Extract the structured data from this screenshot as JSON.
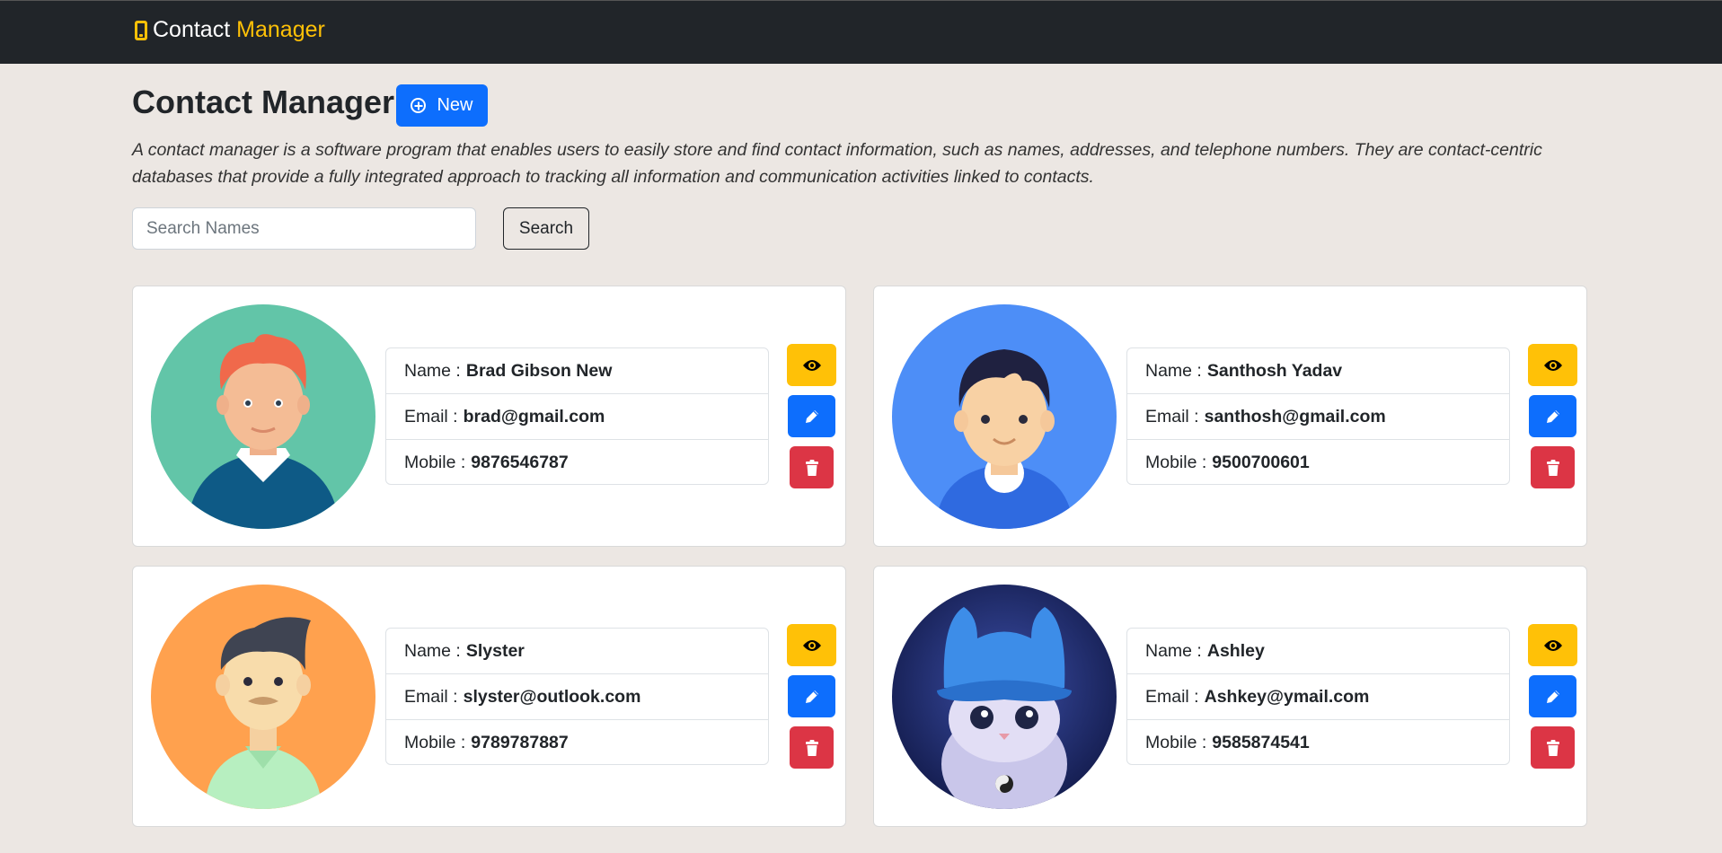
{
  "navbar": {
    "brand_text": "Contact",
    "brand_accent": "Manager",
    "brand_icon": "mobile-phone-icon",
    "accent_color": "#ffc107"
  },
  "header": {
    "title": "Contact Manager",
    "new_button_label": "New",
    "new_button_icon": "plus-circle-icon",
    "description": "A contact manager is a software program that enables users to easily store and find contact information, such as names, addresses, and telephone numbers. They are contact-centric databases that provide a fully integrated approach to tracking all information and communication activities linked to contacts."
  },
  "search": {
    "placeholder": "Search Names",
    "value": "",
    "button_label": "Search"
  },
  "labels": {
    "name": "Name :",
    "email": "Email :",
    "mobile": "Mobile :"
  },
  "actions": {
    "view_icon": "eye-icon",
    "edit_icon": "pencil-icon",
    "delete_icon": "trash-icon",
    "view_color": "#ffc107",
    "edit_color": "#0d6efd",
    "delete_color": "#dc3545"
  },
  "contacts": [
    {
      "name": "Brad Gibson New",
      "email": "brad@gmail.com",
      "mobile": "9876546787",
      "avatar": "red-haired-man-avatar"
    },
    {
      "name": "Santhosh Yadav",
      "email": "santhosh@gmail.com",
      "mobile": "9500700601",
      "avatar": "boy-avatar"
    },
    {
      "name": "Slyster",
      "email": "slyster@outlook.com",
      "mobile": "9789787887",
      "avatar": "mustache-man-avatar"
    },
    {
      "name": "Ashley",
      "email": "Ashkey@ymail.com",
      "mobile": "9585874541",
      "avatar": "blue-hat-cat-avatar"
    }
  ]
}
